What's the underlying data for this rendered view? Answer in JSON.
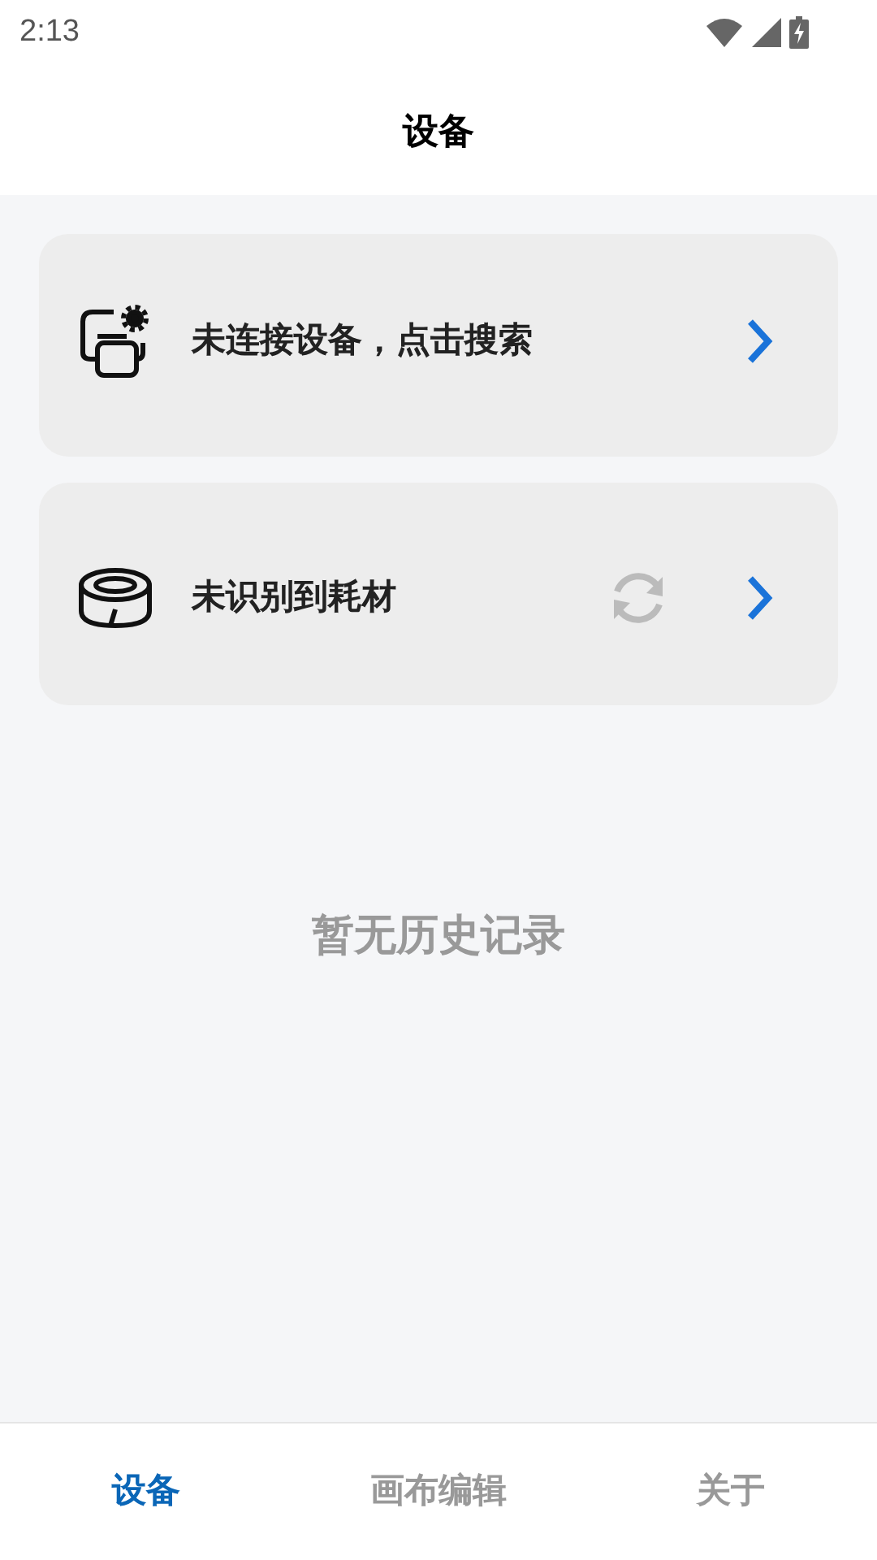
{
  "status_bar": {
    "time": "2:13"
  },
  "header": {
    "title": "设备"
  },
  "cards": [
    {
      "kind": "device",
      "label": "未连接设备，点击搜索",
      "refresh": false
    },
    {
      "kind": "consumable",
      "label": "未识别到耗材",
      "refresh": true
    }
  ],
  "empty_message": "暂无历史记录",
  "tabs": [
    {
      "label": "设备",
      "selected": true
    },
    {
      "label": "画布编辑",
      "selected": false
    },
    {
      "label": "关于",
      "selected": false
    }
  ]
}
